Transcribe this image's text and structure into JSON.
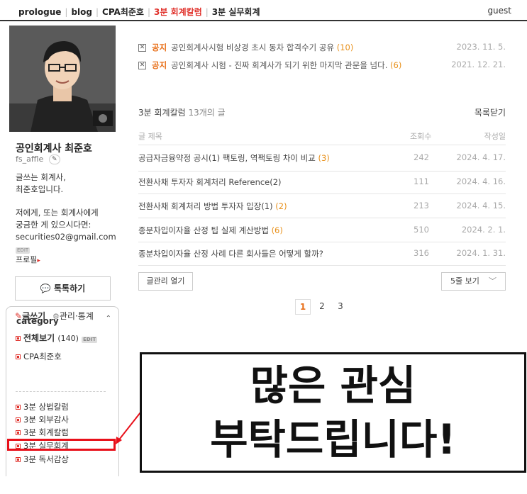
{
  "topnav": {
    "links": [
      "prologue",
      "blog",
      "CPA최준호",
      "3분 회계칼럼",
      "3분 실무회계"
    ],
    "active_index": 3,
    "guest": "guest"
  },
  "sidebar": {
    "blog_name": "공인회계사 최준호",
    "blog_id": "fs_affle",
    "intro_line1": "글쓰는 회계사,",
    "intro_line2": "최준호입니다.",
    "intro_line3": "저에게, 또는 회계사에게",
    "intro_line4": "궁금한 게 있으시다면:",
    "email": "securities02@gmail.com",
    "edit_badge": "EDIT",
    "profile_link": "프로필",
    "talk_button": "톡톡하기",
    "write_label": "글쓰기",
    "manage_label": "관리·통계"
  },
  "category": {
    "title": "category",
    "all_label": "전체보기",
    "all_count": "(140)",
    "all_edit": "EDIT",
    "items": [
      "CPA최준호",
      "3분 상법칼럼",
      "3분 외부감사",
      "3분 회계칼럼",
      "3분 실무회계",
      "3분 독서감상"
    ]
  },
  "notices": [
    {
      "tag": "공지",
      "title": "공인회계사시험 비상경 초시 동차 합격수기 공유",
      "count": "(10)",
      "date": "2023. 11. 5."
    },
    {
      "tag": "공지",
      "title": "공인회계사 시험 - 진짜 회계사가 되기 위한 마지막 관문을 넘다.",
      "count": "(6)",
      "date": "2021. 12. 21."
    }
  ],
  "list": {
    "heading": "3분 회계칼럼",
    "count_text": "13개의 글",
    "close_label": "목록닫기",
    "col_title": "글 제목",
    "col_views": "조회수",
    "col_date": "작성일",
    "rows": [
      {
        "title": "공급자금융약정 공시(1) 팩토링, 역팩토링 차이 비교",
        "cmt": "(3)",
        "views": "242",
        "date": "2024. 4. 17."
      },
      {
        "title": "전환사채 투자자 회계처리 Reference(2)",
        "cmt": "",
        "views": "111",
        "date": "2024. 4. 16."
      },
      {
        "title": "전환사채 회계처리 방법 투자자 입장(1)",
        "cmt": "(2)",
        "views": "213",
        "date": "2024. 4. 15."
      },
      {
        "title": "종분차입이자율 산정 팁 실제 계산방법",
        "cmt": "(6)",
        "views": "510",
        "date": "2024. 2. 1."
      },
      {
        "title": "종분차입이자율 산정 사례 다른 회사들은 어떻게 할까?",
        "cmt": "",
        "views": "316",
        "date": "2024. 1. 31."
      }
    ],
    "manage_button": "글관리 열기",
    "lines_select": "5줄 보기",
    "pages": [
      "1",
      "2",
      "3"
    ]
  },
  "overlay": {
    "line1": "많은 관심",
    "line2": "부탁드립니다!"
  }
}
